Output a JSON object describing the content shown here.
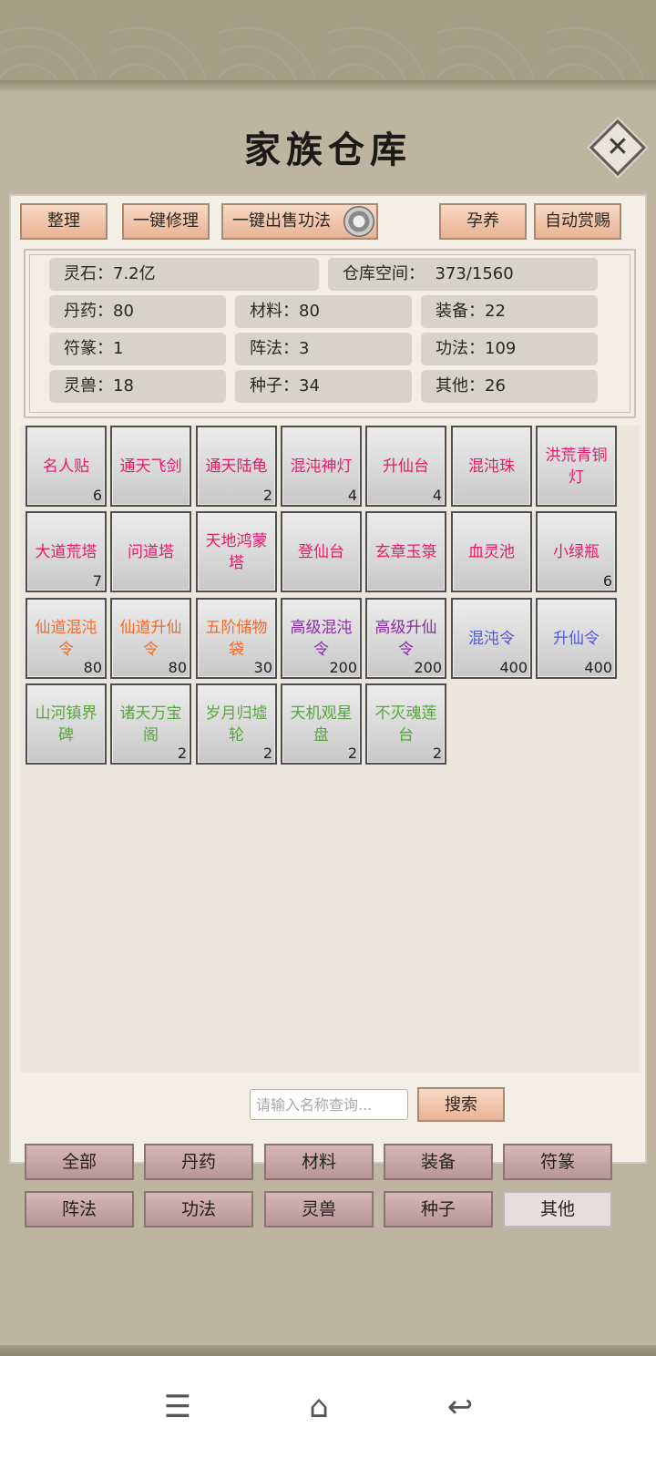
{
  "title": "家族仓库",
  "close_icon": "close-icon",
  "actions": {
    "sort": "整理",
    "repair_all": "一键修理",
    "sell_skills": "一键出售功法",
    "nurture": "孕养",
    "auto_reward": "自动赏赐",
    "settings_icon": "gear-icon"
  },
  "stats": {
    "spirit_stone_label": "灵石：",
    "spirit_stone": "7.2亿",
    "space_label": "仓库空间：",
    "space": "373/1560",
    "pill": "丹药：80",
    "material": "材料：80",
    "equipment": "装备：22",
    "talisman": "符篆：1",
    "formation": "阵法：3",
    "skill": "功法：109",
    "beast": "灵兽：18",
    "seed": "种子：34",
    "other": "其他：26"
  },
  "colors": {
    "pink": "#e8196c",
    "orange": "#f06a2a",
    "purple": "#8a2aa5",
    "blue": "#4e57d8",
    "green": "#56a63a"
  },
  "items": [
    {
      "name": "名人贴",
      "qty": "6",
      "color": "pink"
    },
    {
      "name": "通天飞剑",
      "qty": "",
      "color": "pink"
    },
    {
      "name": "通天陆龟",
      "qty": "2",
      "color": "pink"
    },
    {
      "name": "混沌神灯",
      "qty": "4",
      "color": "pink"
    },
    {
      "name": "升仙台",
      "qty": "4",
      "color": "pink"
    },
    {
      "name": "混沌珠",
      "qty": "",
      "color": "pink"
    },
    {
      "name": "洪荒青铜灯",
      "qty": "",
      "color": "pink"
    },
    {
      "name": "大道荒塔",
      "qty": "7",
      "color": "pink"
    },
    {
      "name": "问道塔",
      "qty": "",
      "color": "pink"
    },
    {
      "name": "天地鸿蒙塔",
      "qty": "",
      "color": "pink"
    },
    {
      "name": "登仙台",
      "qty": "",
      "color": "pink"
    },
    {
      "name": "玄章玉箓",
      "qty": "",
      "color": "pink"
    },
    {
      "name": "血灵池",
      "qty": "",
      "color": "pink"
    },
    {
      "name": "小绿瓶",
      "qty": "6",
      "color": "pink"
    },
    {
      "name": "仙道混沌令",
      "qty": "80",
      "color": "orange"
    },
    {
      "name": "仙道升仙令",
      "qty": "80",
      "color": "orange"
    },
    {
      "name": "五阶储物袋",
      "qty": "30",
      "color": "orange"
    },
    {
      "name": "高级混沌令",
      "qty": "200",
      "color": "purple"
    },
    {
      "name": "高级升仙令",
      "qty": "200",
      "color": "purple"
    },
    {
      "name": "混沌令",
      "qty": "400",
      "color": "blue"
    },
    {
      "name": "升仙令",
      "qty": "400",
      "color": "blue"
    },
    {
      "name": "山河镇界碑",
      "qty": "",
      "color": "green"
    },
    {
      "name": "诸天万宝阁",
      "qty": "2",
      "color": "green"
    },
    {
      "name": "岁月归墟轮",
      "qty": "2",
      "color": "green"
    },
    {
      "name": "天机观星盘",
      "qty": "2",
      "color": "green"
    },
    {
      "name": "不灭魂莲台",
      "qty": "2",
      "color": "green"
    }
  ],
  "search": {
    "placeholder": "请输入名称查询...",
    "button": "搜索"
  },
  "tabs": [
    {
      "label": "全部",
      "active": false
    },
    {
      "label": "丹药",
      "active": false
    },
    {
      "label": "材料",
      "active": false
    },
    {
      "label": "装备",
      "active": false
    },
    {
      "label": "符篆",
      "active": false
    },
    {
      "label": "阵法",
      "active": false
    },
    {
      "label": "功法",
      "active": false
    },
    {
      "label": "灵兽",
      "active": false
    },
    {
      "label": "种子",
      "active": false
    },
    {
      "label": "其他",
      "active": true
    }
  ],
  "nav": {
    "menu_icon": "menu-icon",
    "home_icon": "home-icon",
    "back_icon": "back-icon"
  }
}
